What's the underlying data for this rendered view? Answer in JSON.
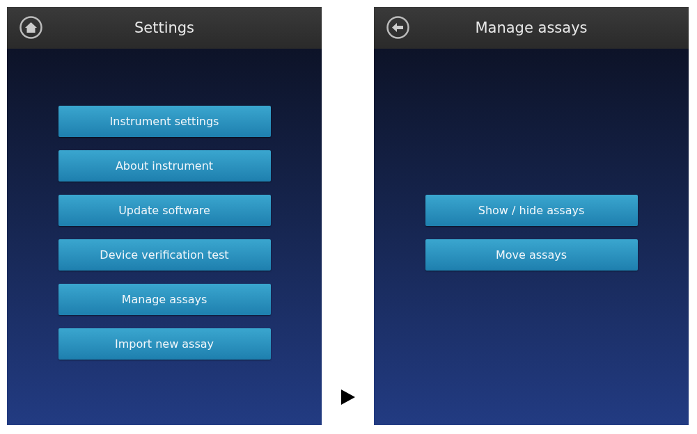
{
  "screens": [
    {
      "header": {
        "title": "Settings"
      },
      "buttons": [
        "Instrument settings",
        "About instrument",
        "Update software",
        "Device verification test",
        "Manage assays",
        "Import new assay"
      ]
    },
    {
      "header": {
        "title": "Manage assays"
      },
      "buttons": [
        "Show / hide assays",
        "Move assays"
      ]
    }
  ]
}
